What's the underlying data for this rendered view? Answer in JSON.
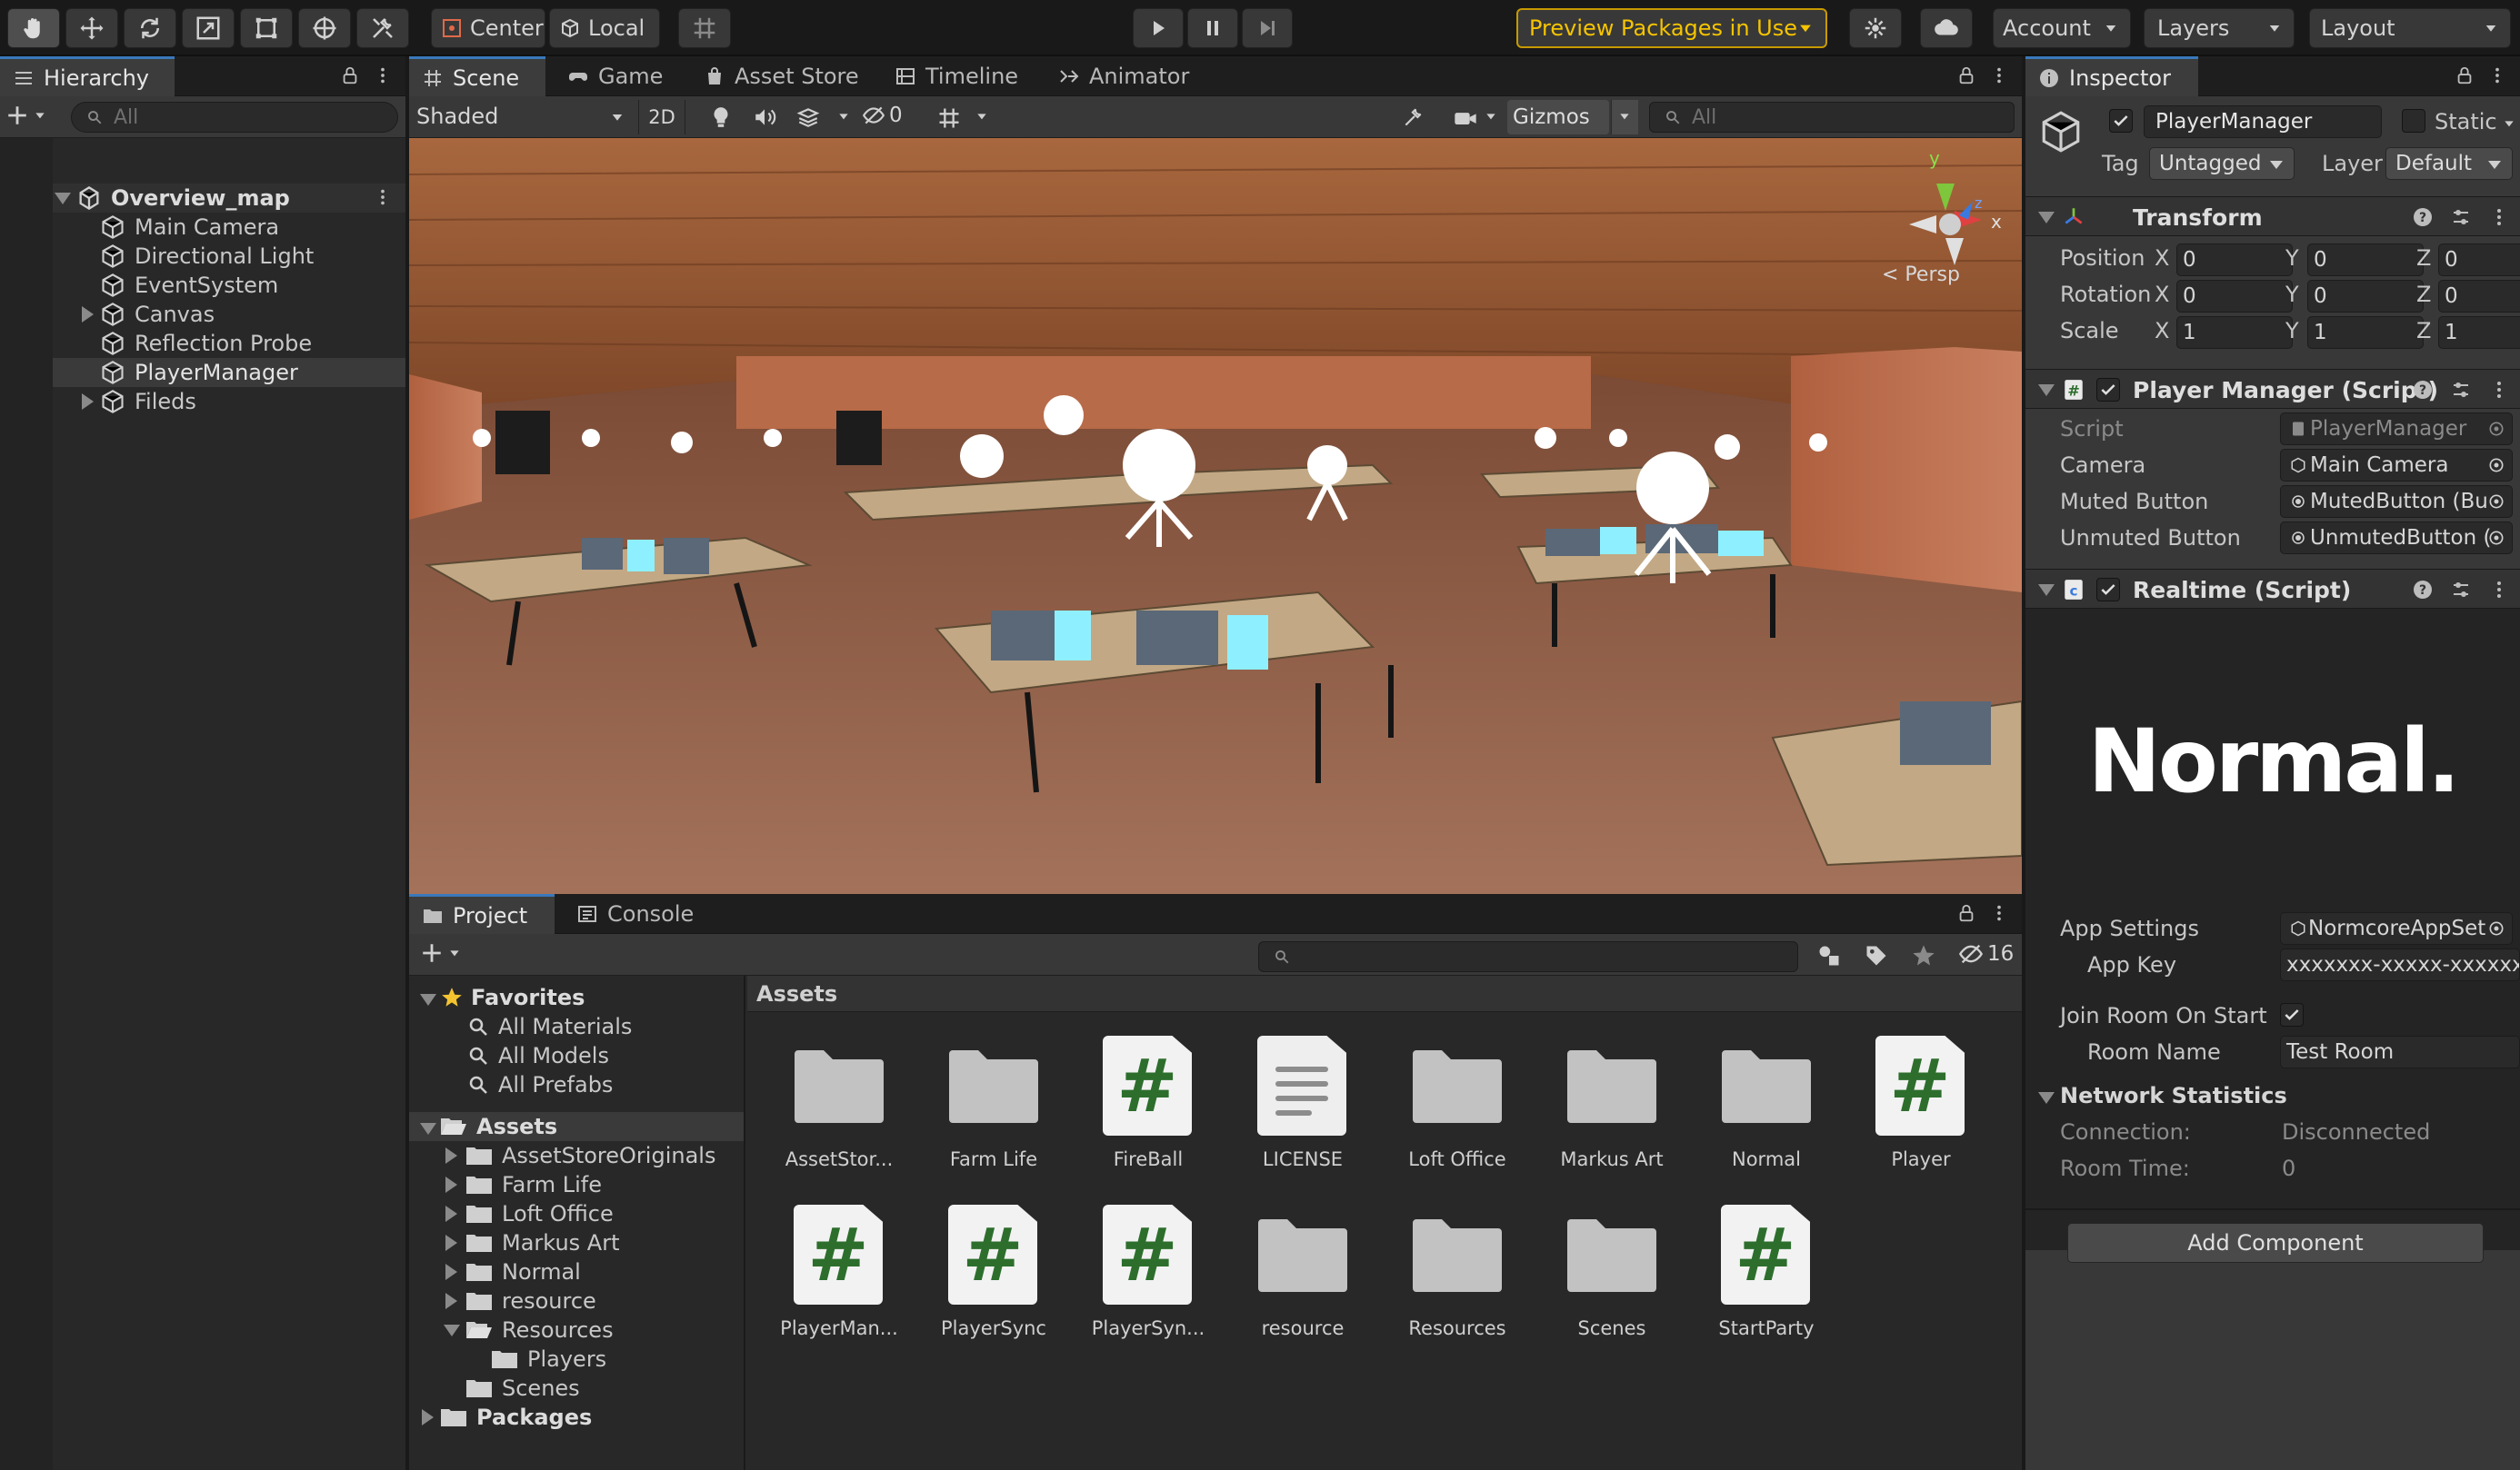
{
  "toolbar": {
    "pivot_center": "Center",
    "pivot_local": "Local",
    "preview_packages": "Preview Packages in Use",
    "account": "Account",
    "layers": "Layers",
    "layout": "Layout",
    "accent": "#f5c400"
  },
  "hierarchy": {
    "tab": "Hierarchy",
    "search_placeholder": "All",
    "scene": "Overview_map",
    "items": [
      "Main Camera",
      "Directional Light",
      "EventSystem",
      "Canvas",
      "Reflection Probe",
      "PlayerManager",
      "Fileds"
    ]
  },
  "scene_view": {
    "tabs": [
      "Scene",
      "Game",
      "Asset Store",
      "Timeline",
      "Animator"
    ],
    "shading": "Shaded",
    "mode_2d": "2D",
    "hidden_count": "0",
    "gizmos": "Gizmos",
    "search_placeholder": "All",
    "persp": "< Persp",
    "axis_x": "x",
    "axis_y": "y",
    "axis_z": "z"
  },
  "project": {
    "tabs": [
      "Project",
      "Console"
    ],
    "count_badge": "16",
    "favorites_title": "Favorites",
    "favorites": [
      "All Materials",
      "All Models",
      "All Prefabs"
    ],
    "assets_title": "Assets",
    "asset_folders": [
      "AssetStoreOriginals",
      "Farm Life",
      "Loft Office",
      "Markus Art",
      "Normal",
      "resource",
      "Resources"
    ],
    "resources_child": "Players",
    "scenes": "Scenes",
    "packages": "Packages",
    "grid_title": "Assets",
    "grid": [
      {
        "name": "AssetStor...",
        "type": "folder"
      },
      {
        "name": "Farm Life",
        "type": "folder"
      },
      {
        "name": "FireBall",
        "type": "script"
      },
      {
        "name": "LICENSE",
        "type": "doc"
      },
      {
        "name": "Loft Office",
        "type": "folder"
      },
      {
        "name": "Markus Art",
        "type": "folder"
      },
      {
        "name": "Normal",
        "type": "folder"
      },
      {
        "name": "Player",
        "type": "script"
      },
      {
        "name": "PlayerMan...",
        "type": "script"
      },
      {
        "name": "PlayerSync",
        "type": "script"
      },
      {
        "name": "PlayerSyn...",
        "type": "script"
      },
      {
        "name": "resource",
        "type": "folder"
      },
      {
        "name": "Resources",
        "type": "folder"
      },
      {
        "name": "Scenes",
        "type": "folder"
      },
      {
        "name": "StartParty",
        "type": "script"
      }
    ]
  },
  "inspector": {
    "tab": "Inspector",
    "object_name": "PlayerManager",
    "static_label": "Static",
    "tag_label": "Tag",
    "tag_value": "Untagged",
    "layer_label": "Layer",
    "layer_value": "Default",
    "transform": {
      "title": "Transform",
      "rows": [
        {
          "label": "Position",
          "x": "0",
          "y": "0",
          "z": "0"
        },
        {
          "label": "Rotation",
          "x": "0",
          "y": "0",
          "z": "0"
        },
        {
          "label": "Scale",
          "x": "1",
          "y": "1",
          "z": "1"
        }
      ],
      "x": "X",
      "y": "Y",
      "z": "Z"
    },
    "player_manager": {
      "title": "Player Manager (Script)",
      "script_label": "Script",
      "script_value": "PlayerManager",
      "camera_label": "Camera",
      "camera_value": "Main Camera",
      "muted_label": "Muted Button",
      "muted_value": "MutedButton (Bu",
      "unmuted_label": "Unmuted Button",
      "unmuted_value": "UnmutedButton ("
    },
    "realtime": {
      "title": "Realtime (Script)",
      "logo": "Normal.",
      "app_settings_label": "App Settings",
      "app_settings_value": "NormcoreAppSet",
      "app_key_label": "App Key",
      "app_key_value": "xxxxxxx-xxxxx-xxxxxx-",
      "join_label": "Join Room On Start",
      "room_name_label": "Room Name",
      "room_name_value": "Test Room",
      "network_title": "Network Statistics",
      "connection_label": "Connection:",
      "connection_value": "Disconnected",
      "room_time_label": "Room Time:",
      "room_time_value": "0"
    },
    "add_component": "Add Component"
  }
}
